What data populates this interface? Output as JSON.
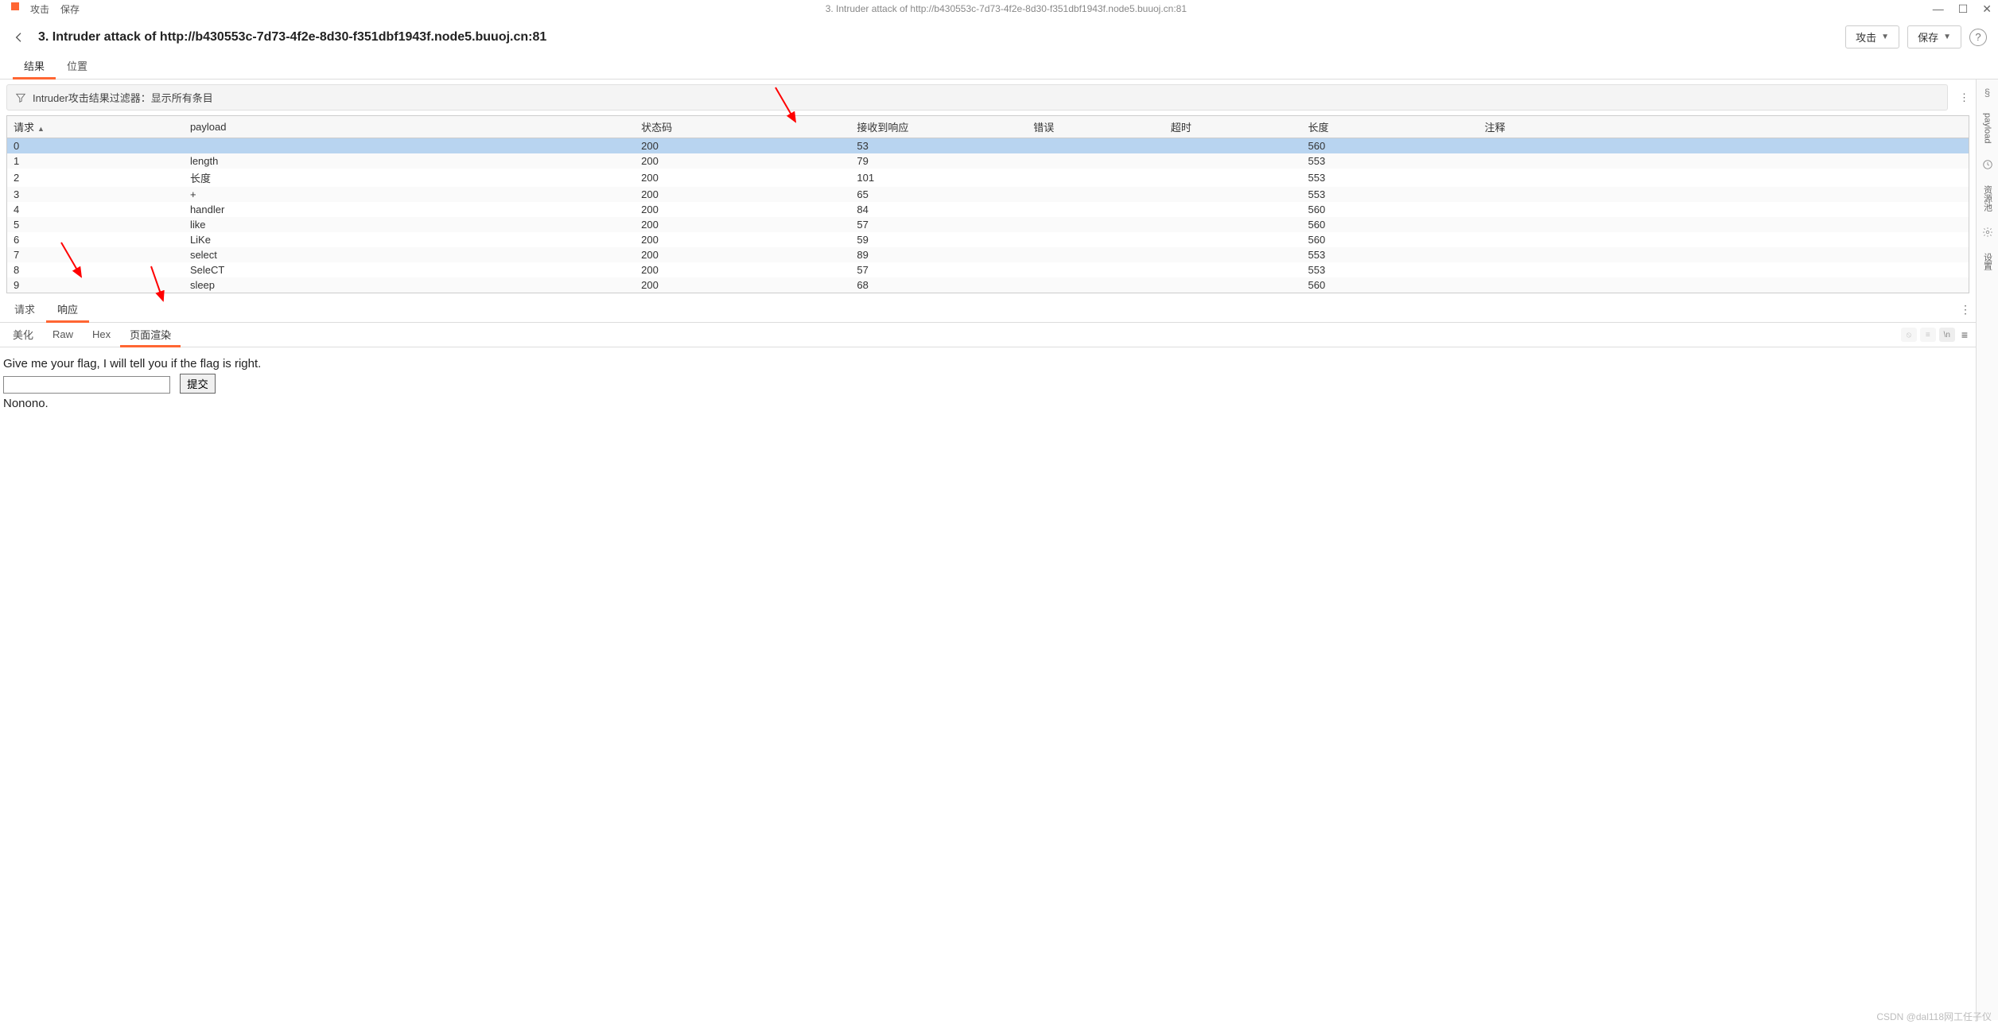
{
  "window": {
    "title": "3. Intruder attack of http://b430553c-7d73-4f2e-8d30-f351dbf1943f.node5.buuoj.cn:81",
    "menu_attack": "攻击",
    "menu_save": "保存"
  },
  "header": {
    "title": "3. Intruder attack of http://b430553c-7d73-4f2e-8d30-f351dbf1943f.node5.buuoj.cn:81",
    "btn_attack": "攻击",
    "btn_save": "保存"
  },
  "tabs": {
    "results": "结果",
    "positions": "位置"
  },
  "filter": {
    "text": "Intruder攻击结果过滤器：显示所有条目"
  },
  "columns": {
    "request": "请求",
    "payload": "payload",
    "status": "状态码",
    "received": "接收到响应",
    "error": "错误",
    "timeout": "超时",
    "length": "长度",
    "comment": "注释"
  },
  "rows": [
    {
      "req": "0",
      "payload": "",
      "status": "200",
      "recv": "53",
      "len": "560"
    },
    {
      "req": "1",
      "payload": "length",
      "status": "200",
      "recv": "79",
      "len": "553"
    },
    {
      "req": "2",
      "payload": "长度",
      "status": "200",
      "recv": "101",
      "len": "553"
    },
    {
      "req": "3",
      "payload": "+",
      "status": "200",
      "recv": "65",
      "len": "553"
    },
    {
      "req": "4",
      "payload": "handler",
      "status": "200",
      "recv": "84",
      "len": "560"
    },
    {
      "req": "5",
      "payload": "like",
      "status": "200",
      "recv": "57",
      "len": "560"
    },
    {
      "req": "6",
      "payload": "LiKe",
      "status": "200",
      "recv": "59",
      "len": "560"
    },
    {
      "req": "7",
      "payload": "select",
      "status": "200",
      "recv": "89",
      "len": "553"
    },
    {
      "req": "8",
      "payload": "SeleCT",
      "status": "200",
      "recv": "57",
      "len": "553"
    },
    {
      "req": "9",
      "payload": "sleep",
      "status": "200",
      "recv": "68",
      "len": "560"
    }
  ],
  "detail_tabs": {
    "request": "请求",
    "response": "响应"
  },
  "sub_tabs": {
    "pretty": "美化",
    "raw": "Raw",
    "hex": "Hex",
    "render": "页面渲染"
  },
  "render": {
    "line1": "Give me your flag, I will tell you if the flag is right.",
    "submit": "提交",
    "line2": "Nonono."
  },
  "mini": {
    "a": "⦸",
    "b": "≡",
    "c": "\\n"
  },
  "sidebar": {
    "payload": "payload",
    "pool": "资源池",
    "settings": "设置"
  },
  "watermark": "CSDN @dal118网工任子仪"
}
